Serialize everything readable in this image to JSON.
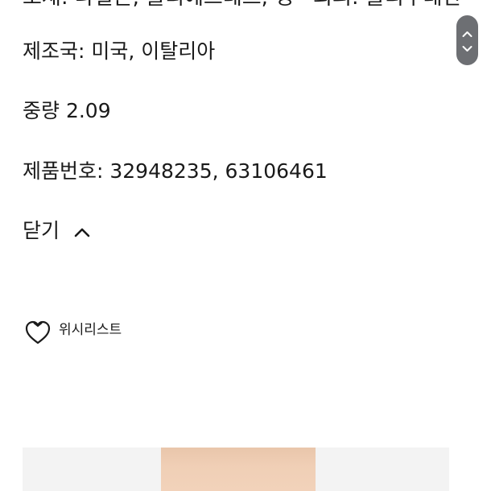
{
  "details": {
    "cut_line": "소재: 나일론, 폴리에스테르, 정ㆍ외피: 폴리우레탄",
    "country": "제조국: 미국, 이탈리아",
    "weight": "중량 2.09",
    "product_number": "제품번호: 32948235, 63106461"
  },
  "toggle": {
    "label": "닫기"
  },
  "wishlist": {
    "label": "위시리스트"
  },
  "icons": {
    "chevron": "chevron-up-icon",
    "heart": "heart-icon",
    "scroll_up": "chevron-up-icon",
    "scroll_down": "chevron-down-icon"
  },
  "colors": {
    "text": "#1a1a1a",
    "scrollbar": "#6d6f73",
    "image_bg": "#f3f3f3"
  }
}
